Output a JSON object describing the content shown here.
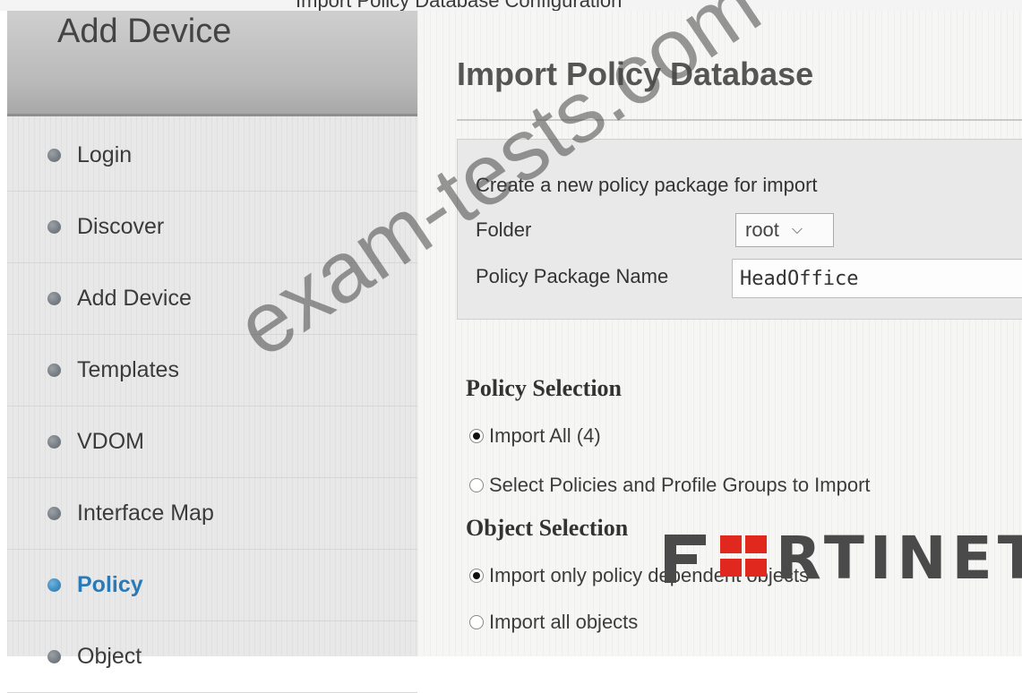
{
  "header_strip_text": "Import Policy Database Configuration",
  "sidebar": {
    "title": "Add Device",
    "items": [
      {
        "label": "Login",
        "active": false
      },
      {
        "label": "Discover",
        "active": false
      },
      {
        "label": "Add Device",
        "active": false
      },
      {
        "label": "Templates",
        "active": false
      },
      {
        "label": "VDOM",
        "active": false
      },
      {
        "label": "Interface Map",
        "active": false
      },
      {
        "label": "Policy",
        "active": true
      },
      {
        "label": "Object",
        "active": false
      }
    ]
  },
  "main": {
    "title": "Import Policy Database",
    "package_box": {
      "heading": "Create a new policy package for import",
      "folder_label": "Folder",
      "folder_value": "root",
      "package_name_label": "Policy Package Name",
      "package_name_value": "HeadOffice"
    },
    "policy_selection": {
      "heading": "Policy Selection",
      "options": [
        {
          "label": "Import All (4)",
          "checked": true
        },
        {
          "label": "Select Policies and Profile Groups to Import",
          "checked": false
        }
      ]
    },
    "object_selection": {
      "heading": "Object Selection",
      "options": [
        {
          "label": "Import only policy dependent objects",
          "checked": true
        },
        {
          "label": "Import all objects",
          "checked": false
        }
      ]
    }
  },
  "brand": {
    "logo_text": "FORTINET",
    "logo_suffix": "RTINET",
    "accent_color": "#e0281e",
    "active_color": "#2a7ab8"
  },
  "watermark": "exam-tests.com"
}
